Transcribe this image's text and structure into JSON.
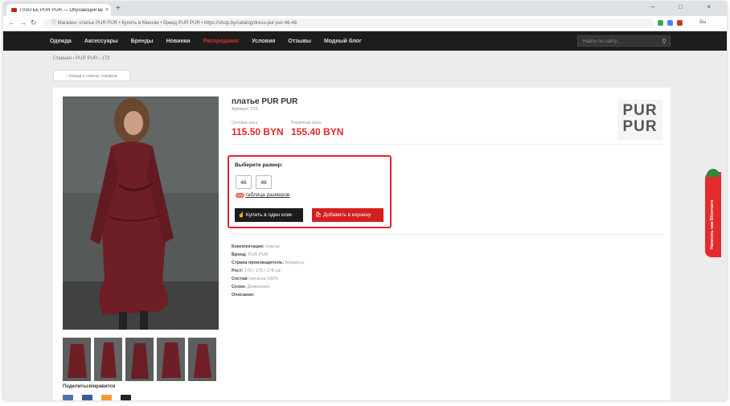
{
  "browser": {
    "tab_title": "ПЛАТЬЕ PUR PUR — Обучающий магазин",
    "close_glyph": "×",
    "new_tab_glyph": "+",
    "window_controls": "– □ ×",
    "url": "Магазин: платье PUR PUR • Купить в Минске • бренд PUR PUR • https://shop.by/catalog/dress-pur-pur-46-48",
    "back_glyph": "←",
    "forward_glyph": "→",
    "reload_glyph": "↻",
    "info_glyph": "ⓘ",
    "profile_label": "Вы"
  },
  "site_nav": {
    "items": [
      "Одежда",
      "Аксессуары",
      "Бренды",
      "Новинки",
      "Распродажа!",
      "Условия",
      "Отзывы",
      "Модный блог"
    ],
    "search_placeholder": "Найти по сайту...",
    "search_icon_glyph": "⚲"
  },
  "breadcrumb": "Главная › PUR PUR › 172",
  "back_button": "‹ Назад к списку товаров",
  "product": {
    "title": "платье PUR PUR",
    "sku": "Артикул: 172",
    "old_price_label": "Оптовая цена",
    "old_price": "115.50 BYN",
    "retail_price_label": "Розничная цена",
    "retail_price": "155.40 BYN",
    "brand_logo_line1": "PUR",
    "brand_logo_line2": "PUR"
  },
  "size_picker": {
    "title": "Выберите размер:",
    "sizes": [
      "46",
      "48"
    ],
    "size_table_label": "таблица размеров",
    "buy_one_click": "Купить в один клик",
    "add_to_cart": "Добавить в корзину",
    "hand_icon_glyph": "☝",
    "bag_icon_glyph": "🛍"
  },
  "attributes": [
    {
      "label": "Комплектация:",
      "value": "платье"
    },
    {
      "label": "Бренд:",
      "value": "PUR PUR"
    },
    {
      "label": "Страна производитель:",
      "value": "Беларусь"
    },
    {
      "label": "Рост:",
      "value": "170 / 175 / 178 см"
    },
    {
      "label": "Состав:",
      "value": "вискоза 100%"
    },
    {
      "label": "Сезон:",
      "value": "Демисезон"
    },
    {
      "label": "Описание:",
      "value": ""
    }
  ],
  "share_label": "Поделиться/нравится",
  "side_tab_label": "Написать нам ВКонтакте",
  "colors": {
    "accent_red": "#e3252c",
    "header_dark": "#1d1d1d",
    "button_dark": "#1c1c1c",
    "button_red": "#d51f1f",
    "social_vk": "#4a76a8",
    "social_fb": "#3b5998",
    "social_ok": "#f59a2e",
    "social_tw": "#222222"
  }
}
